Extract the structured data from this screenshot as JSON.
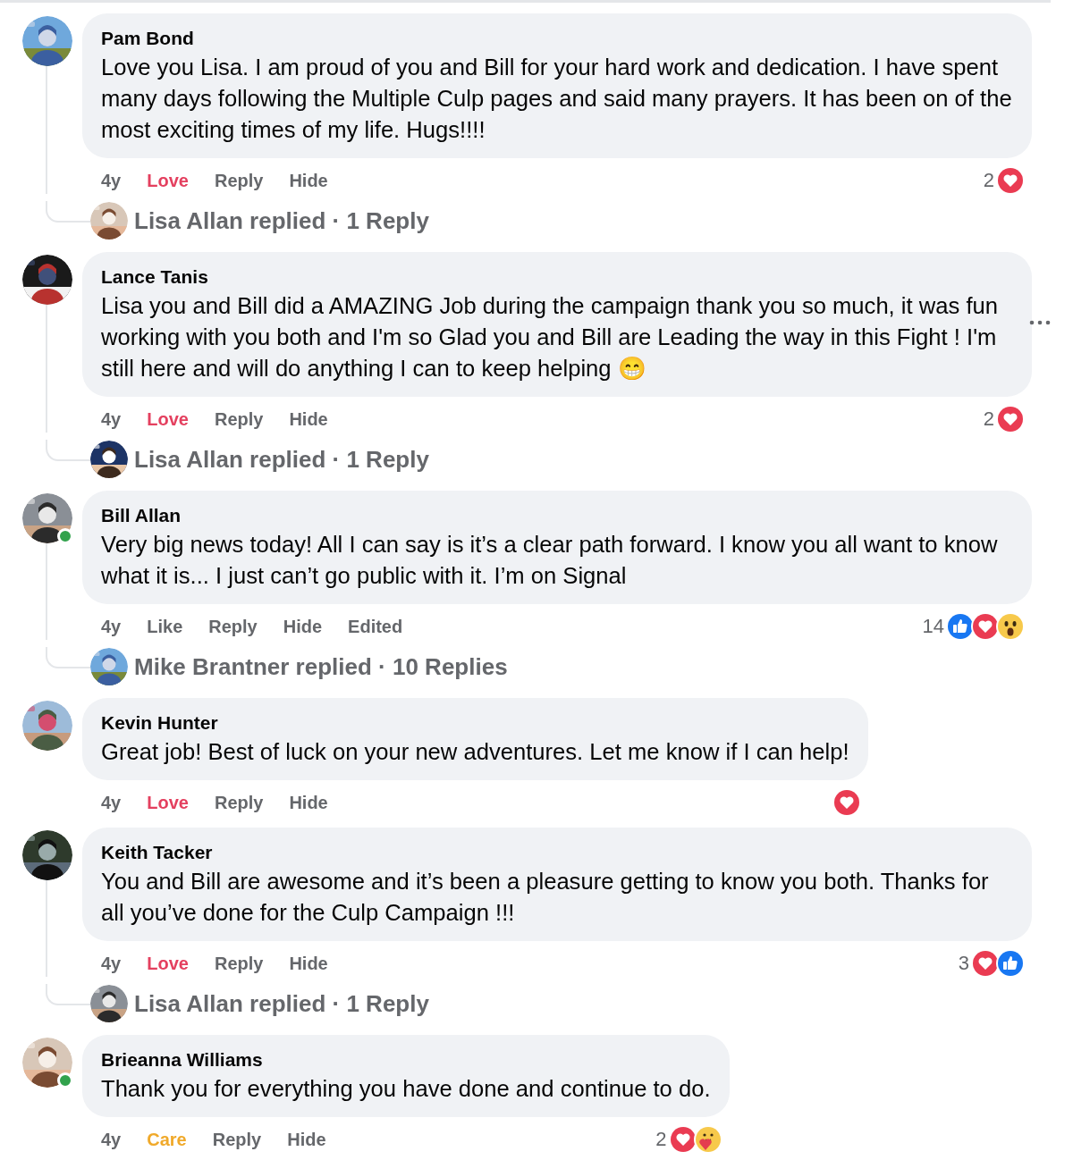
{
  "comments": [
    {
      "author": "Pam Bond",
      "text": "Love you Lisa. I am proud of you and Bill for your hard work and dedication. I have spent many days following the Multiple Culp pages and said many prayers. It has been on of the most exciting times of my life. Hugs!!!!",
      "online": false,
      "more_menu": false,
      "actions": [
        {
          "label": "4y",
          "kind": "time"
        },
        {
          "label": "Love",
          "kind": "love"
        },
        {
          "label": "Reply",
          "kind": "plain"
        },
        {
          "label": "Hide",
          "kind": "plain"
        }
      ],
      "reaction_count": "2",
      "reactions": [
        {
          "kind": "love"
        }
      ],
      "replies": {
        "summary": "Lisa Allan replied · 1 Reply"
      }
    },
    {
      "author": "Lance Tanis",
      "text": "Lisa you and Bill did a AMAZING Job during the campaign thank you so much, it was fun working with you both and I'm so Glad you and Bill are Leading the way in this Fight ! I'm still here and will do anything I can to keep helping 😁",
      "online": false,
      "more_menu": true,
      "actions": [
        {
          "label": "4y",
          "kind": "time"
        },
        {
          "label": "Love",
          "kind": "love"
        },
        {
          "label": "Reply",
          "kind": "plain"
        },
        {
          "label": "Hide",
          "kind": "plain"
        }
      ],
      "reaction_count": "2",
      "reactions": [
        {
          "kind": "love"
        }
      ],
      "replies": {
        "summary": "Lisa Allan replied · 1 Reply"
      }
    },
    {
      "author": "Bill Allan",
      "text": "Very big news today! All I can say is it’s a clear path forward. I know you all want to know what it is... I just can’t go public with it. I’m on Signal",
      "online": true,
      "more_menu": false,
      "actions": [
        {
          "label": "4y",
          "kind": "time"
        },
        {
          "label": "Like",
          "kind": "plain"
        },
        {
          "label": "Reply",
          "kind": "plain"
        },
        {
          "label": "Hide",
          "kind": "plain"
        },
        {
          "label": "Edited",
          "kind": "plain"
        }
      ],
      "reaction_count": "14",
      "reactions": [
        {
          "kind": "like"
        },
        {
          "kind": "love"
        },
        {
          "kind": "wow"
        }
      ],
      "replies": {
        "summary": "Mike Brantner replied · 10 Replies"
      }
    },
    {
      "author": "Kevin Hunter",
      "text": "Great job! Best of luck on your new adventures. Let me know if I can help!",
      "online": false,
      "more_menu": false,
      "actions": [
        {
          "label": "4y",
          "kind": "time"
        },
        {
          "label": "Love",
          "kind": "love"
        },
        {
          "label": "Reply",
          "kind": "plain"
        },
        {
          "label": "Hide",
          "kind": "plain"
        }
      ],
      "reactions": [
        {
          "kind": "love"
        }
      ]
    },
    {
      "author": "Keith Tacker",
      "text": "You and Bill are awesome and it’s been a pleasure getting to know you both. Thanks for all you’ve done for the Culp Campaign !!!",
      "online": false,
      "more_menu": false,
      "actions": [
        {
          "label": "4y",
          "kind": "time"
        },
        {
          "label": "Love",
          "kind": "love"
        },
        {
          "label": "Reply",
          "kind": "plain"
        },
        {
          "label": "Hide",
          "kind": "plain"
        }
      ],
      "reaction_count": "3",
      "reactions": [
        {
          "kind": "love"
        },
        {
          "kind": "like"
        }
      ],
      "replies": {
        "summary": "Lisa Allan replied · 1 Reply"
      }
    },
    {
      "author": "Brieanna Williams",
      "text": "Thank you for everything you have done and continue to do.",
      "online": true,
      "more_menu": false,
      "actions": [
        {
          "label": "4y",
          "kind": "time"
        },
        {
          "label": "Care",
          "kind": "care"
        },
        {
          "label": "Reply",
          "kind": "plain"
        },
        {
          "label": "Hide",
          "kind": "plain"
        }
      ],
      "reaction_count": "2",
      "reactions": [
        {
          "kind": "love"
        },
        {
          "kind": "care"
        }
      ]
    }
  ]
}
